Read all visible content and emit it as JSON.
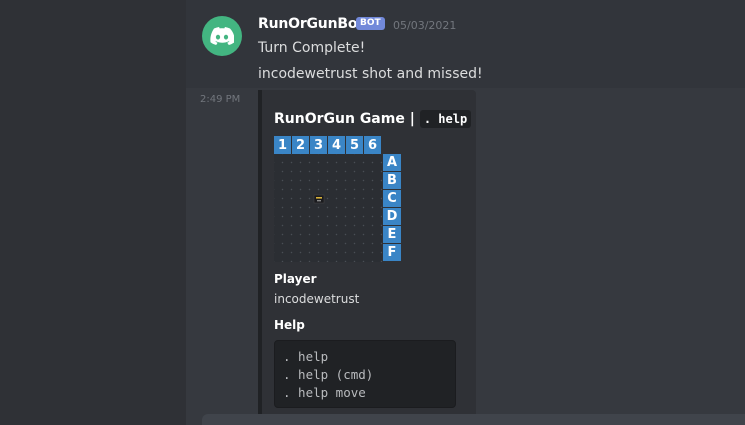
{
  "message": {
    "author": "RunOrGunBot",
    "tag": "BOT",
    "date": "05/03/2021",
    "lines": [
      "Turn Complete!",
      "incodewetrust shot and missed!"
    ],
    "side_time": "2:49 PM"
  },
  "embed": {
    "title": "RunOrGun Game |",
    "title_code": ". help",
    "board": {
      "columns": [
        "1",
        "2",
        "3",
        "4",
        "5",
        "6"
      ],
      "rows": [
        "A",
        "B",
        "C",
        "D",
        "E",
        "F"
      ]
    },
    "fields": [
      {
        "name": "Player",
        "value": "incodewetrust"
      },
      {
        "name": "Help",
        "code_lines": [
          ". help",
          ". help (cmd)",
          ". help move"
        ]
      }
    ]
  },
  "colors": {
    "background": "#36393f",
    "embed_bg": "#2f3136",
    "label_blue": "#3a85c6",
    "avatar_green": "#43b581",
    "bot_tag": "#7289da"
  },
  "icons": {
    "avatar": "discord-logo-icon",
    "player": "player-piece-icon"
  }
}
